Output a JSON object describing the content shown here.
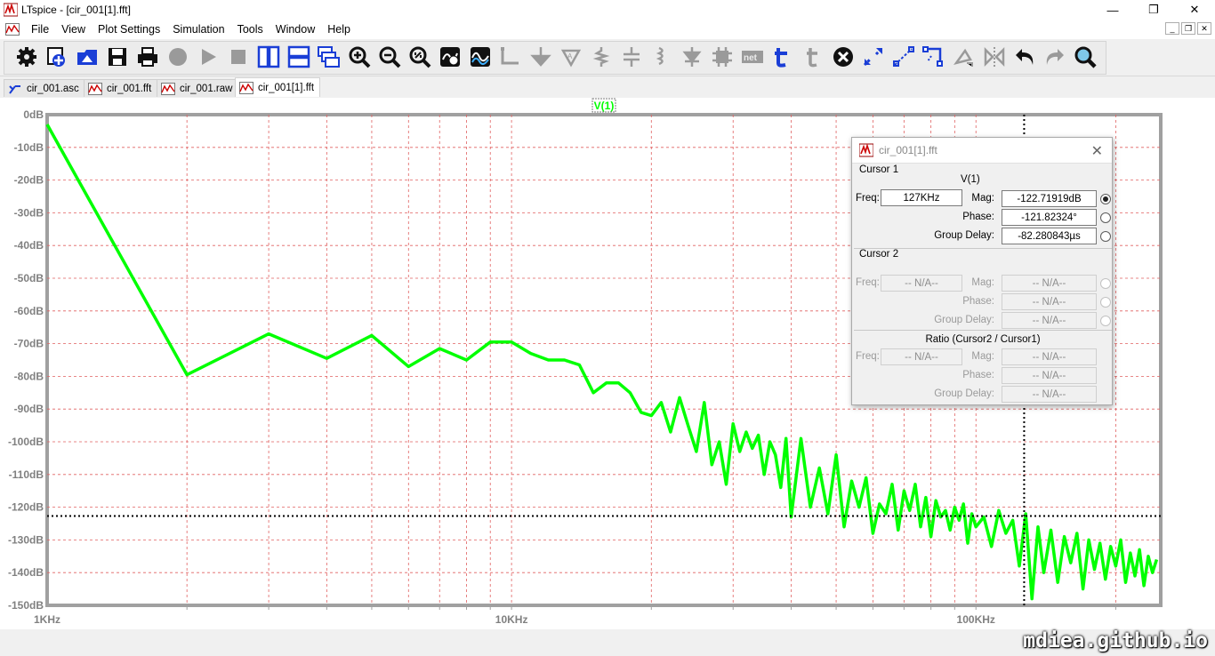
{
  "window": {
    "title": "LTspice - [cir_001[1].fft]",
    "minimize": "—",
    "maximize": "❐",
    "close": "✕"
  },
  "menu": [
    "File",
    "View",
    "Plot Settings",
    "Simulation",
    "Tools",
    "Window",
    "Help"
  ],
  "mdi_controls": [
    "_",
    "❐",
    "✕"
  ],
  "toolbar_icons": [
    "settings-icon",
    "open-schematic-icon",
    "open-file-icon",
    "save-icon",
    "print-icon",
    "halt-icon",
    "run-icon",
    "stop-icon",
    "tile-vertical-icon",
    "tile-horizontal-icon",
    "cascade-icon",
    "zoom-in-icon",
    "zoom-out-icon",
    "zoom-fit-icon",
    "autorange-icon",
    "plot-wave-icon",
    "wire-icon",
    "ground-icon",
    "label-net-icon",
    "resistor-icon",
    "capacitor-icon",
    "inductor-icon",
    "diode-icon",
    "component-icon",
    "spice-directive-icon",
    "text-icon",
    "cut-icon",
    "delete-icon",
    "move-icon",
    "drag-icon",
    "rotate-icon",
    "mirror-icon",
    "flip-icon",
    "undo-icon",
    "redo-icon",
    "find-icon"
  ],
  "toolbar_text": {
    "net": "net"
  },
  "tabs": [
    {
      "label": "cir_001.asc",
      "icon": "schematic-icon"
    },
    {
      "label": "cir_001.fft",
      "icon": "waveform-icon"
    },
    {
      "label": "cir_001.raw",
      "icon": "waveform-icon"
    },
    {
      "label": "cir_001[1].fft",
      "icon": "waveform-icon",
      "active": true
    }
  ],
  "trace_label": "V(1)",
  "colors": {
    "trace": "#00ff00",
    "grid_h": "#e06060",
    "axis_text": "#808080",
    "cursor": "#000000"
  },
  "chart_data": {
    "type": "line",
    "title": "",
    "xlabel": "",
    "ylabel": "",
    "x_scale": "log",
    "xlim": [
      1000,
      250000
    ],
    "ylim": [
      -150,
      0
    ],
    "x_tick_labels": [
      "1KHz",
      "10KHz",
      "100KHz"
    ],
    "y_tick_labels": [
      "0dB",
      "-10dB",
      "-20dB",
      "-30dB",
      "-40dB",
      "-50dB",
      "-60dB",
      "-70dB",
      "-80dB",
      "-90dB",
      "-100dB",
      "-110dB",
      "-120dB",
      "-130dB",
      "-140dB",
      "-150dB"
    ],
    "grid": true,
    "cursor": {
      "x": 127000,
      "y": -122.7
    },
    "series": [
      {
        "name": "V(1)",
        "x": [
          1000,
          2000,
          3000,
          4000,
          5000,
          6000,
          7000,
          8000,
          9000,
          10000,
          11000,
          12000,
          13000,
          14000,
          15000,
          16000,
          17000,
          18000,
          19000,
          20000,
          21000,
          22000,
          23000,
          24000,
          25000,
          26000,
          27000,
          28000,
          29000,
          30000,
          31000,
          32000,
          33000,
          34000,
          35000,
          36000,
          37000,
          38000,
          39000,
          40000,
          42000,
          44000,
          46000,
          48000,
          50000,
          52000,
          54000,
          56000,
          58000,
          60000,
          62000,
          64000,
          66000,
          68000,
          70000,
          72000,
          74000,
          76000,
          78000,
          80000,
          82000,
          84000,
          86000,
          88000,
          90000,
          92000,
          94000,
          96000,
          98000,
          100000,
          104000,
          108000,
          112000,
          116000,
          120000,
          124000,
          128000,
          132000,
          136000,
          140000,
          145000,
          150000,
          155000,
          160000,
          165000,
          170000,
          175000,
          180000,
          185000,
          190000,
          195000,
          200000,
          205000,
          210000,
          215000,
          220000,
          225000,
          230000,
          235000,
          240000,
          245000
        ],
        "y": [
          -3,
          -79.5,
          -67,
          -74.5,
          -67.5,
          -77,
          -71.5,
          -75,
          -69.5,
          -69.5,
          -73,
          -75,
          -75,
          -76.5,
          -85,
          -82,
          -82,
          -85,
          -91,
          -92,
          -88,
          -97,
          -86.5,
          -95,
          -103,
          -88,
          -107,
          -100,
          -113,
          -94.5,
          -103,
          -97,
          -102,
          -98,
          -110,
          -100,
          -104,
          -114,
          -99,
          -123,
          -99,
          -120,
          -108,
          -122,
          -104,
          -126,
          -112,
          -120,
          -111,
          -128,
          -119,
          -122,
          -113,
          -127,
          -115,
          -121,
          -113,
          -126,
          -117,
          -129,
          -118,
          -123,
          -121,
          -127,
          -120,
          -124,
          -119,
          -131,
          -122,
          -126,
          -123,
          -132,
          -121,
          -128,
          -124,
          -138,
          -122,
          -148,
          -126,
          -140,
          -127,
          -143,
          -129,
          -137,
          -128,
          -145,
          -130,
          -139,
          -131,
          -142,
          -132,
          -138,
          -130,
          -143,
          -134,
          -141,
          -133,
          -144,
          -135,
          -140,
          -136
        ]
      }
    ]
  },
  "dialog": {
    "title": "cir_001[1].fft",
    "close": "✕",
    "cursor1": {
      "label": "Cursor 1",
      "trace": "V(1)",
      "freq_label": "Freq:",
      "freq": "127KHz",
      "mag_label": "Mag:",
      "mag": "-122.71919dB",
      "phase_label": "Phase:",
      "phase": "-121.82324°",
      "gd_label": "Group Delay:",
      "gd": "-82.280843µs"
    },
    "cursor2": {
      "label": "Cursor 2",
      "freq_label": "Freq:",
      "freq": "-- N/A--",
      "mag_label": "Mag:",
      "mag": "-- N/A--",
      "phase_label": "Phase:",
      "phase": "-- N/A--",
      "gd_label": "Group Delay:",
      "gd": "-- N/A--"
    },
    "ratio": {
      "label": "Ratio (Cursor2 / Cursor1)",
      "freq_label": "Freq:",
      "freq": "-- N/A--",
      "mag_label": "Mag:",
      "mag": "-- N/A--",
      "phase_label": "Phase:",
      "phase": "-- N/A--",
      "gd_label": "Group Delay:",
      "gd": "-- N/A--"
    }
  },
  "watermark": "mdiea.github.io"
}
